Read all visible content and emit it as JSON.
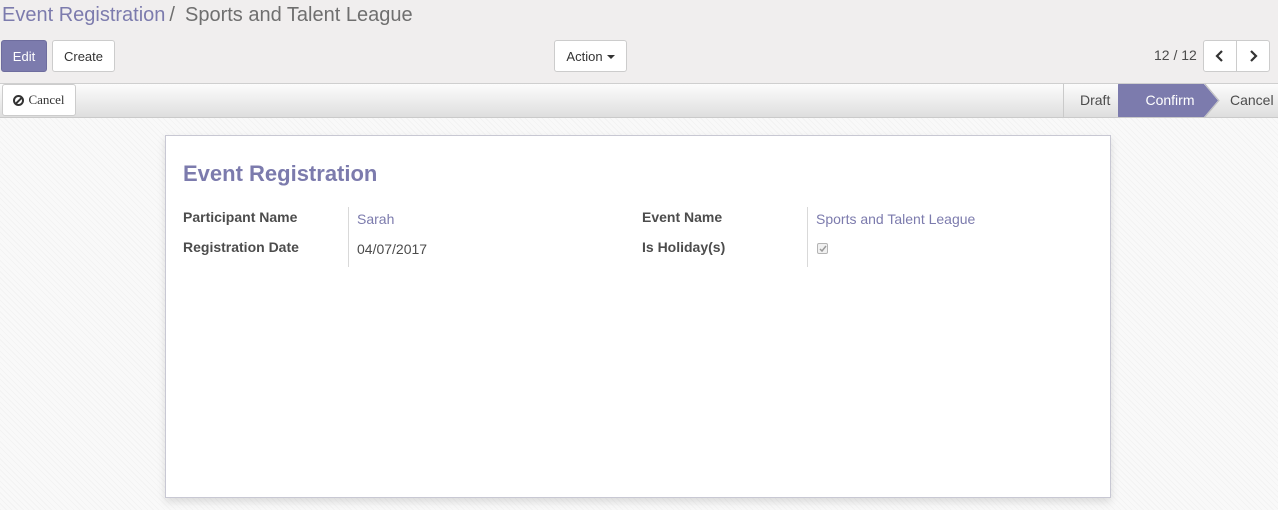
{
  "breadcrumb": {
    "parent": "Event Registration",
    "separator": "/",
    "current": "Sports and Talent League"
  },
  "toolbar": {
    "edit_label": "Edit",
    "create_label": "Create",
    "action_label": "Action"
  },
  "pager": {
    "value": "12 / 12",
    "prev_icon": "chevron-left-icon",
    "next_icon": "chevron-right-icon"
  },
  "statusbar": {
    "cancel_button_label": "Cancel",
    "stages": [
      "Draft",
      "Confirm",
      "Cancel"
    ],
    "active_stage": "Confirm"
  },
  "form": {
    "title": "Event Registration",
    "participant_name_label": "Participant Name",
    "participant_name_value": "Sarah",
    "registration_date_label": "Registration Date",
    "registration_date_value": "04/07/2017",
    "event_name_label": "Event Name",
    "event_name_value": "Sports and Talent League",
    "is_holiday_label": "Is Holiday(s)",
    "is_holiday_checked": true
  },
  "colors": {
    "accent": "#7c7bad",
    "active_stage_bg": "#7c7bad"
  }
}
